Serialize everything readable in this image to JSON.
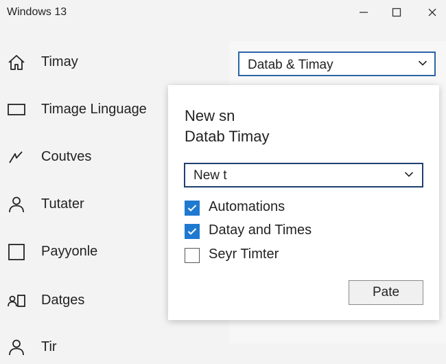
{
  "window": {
    "title": "Windows 13",
    "controls": [
      "minimize-icon",
      "maximize-icon",
      "close-icon"
    ]
  },
  "sidebar": {
    "items": [
      {
        "label": "Timay",
        "icon": "home-icon"
      },
      {
        "label": "Timage Linguage",
        "icon": "display-icon"
      },
      {
        "label": "Coutves",
        "icon": "pen-icon"
      },
      {
        "label": "Tutater",
        "icon": "person-icon"
      },
      {
        "label": "Payyonle",
        "icon": "square-icon"
      },
      {
        "label": "Datges",
        "icon": "people-icon"
      },
      {
        "label": "Tir",
        "icon": "person-icon"
      }
    ]
  },
  "header_dropdown": {
    "value": "Datab & Timay"
  },
  "panel": {
    "heading_line1": "New sn",
    "heading_line2": "Datab Timay",
    "dropdown_value": "New t",
    "checkboxes": [
      {
        "label": "Automations",
        "checked": true
      },
      {
        "label": "Datay and Times",
        "checked": true
      },
      {
        "label": "Seyr Timter",
        "checked": false
      }
    ],
    "button_label": "Pate"
  },
  "colors": {
    "accent": "#1f79d1",
    "focus_border": "#2a65a8",
    "window_bg": "#f3f3f3",
    "panel_bg": "#ffffff"
  }
}
